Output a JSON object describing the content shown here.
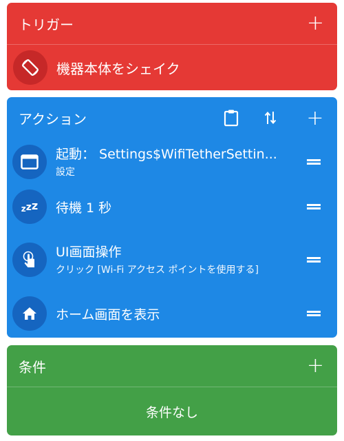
{
  "trigger": {
    "title": "トリガー",
    "items": [
      {
        "label": "機器本体をシェイク",
        "icon": "screen-rotation-icon"
      }
    ]
  },
  "action": {
    "title": "アクション",
    "items": [
      {
        "title": "起動： Settings$WifiTetherSettin...",
        "subtitle": "設定",
        "icon": "window-icon"
      },
      {
        "title": "待機 1 秒",
        "icon": "sleep-zzz-icon"
      },
      {
        "title": "UI画面操作",
        "subtitle": "クリック [Wi-Fi アクセス ポイントを使用する]",
        "icon": "touch-icon"
      },
      {
        "title": "ホーム画面を表示",
        "icon": "home-icon"
      }
    ]
  },
  "constraint": {
    "title": "条件",
    "empty_text": "条件なし"
  },
  "colors": {
    "trigger": "#e53935",
    "action": "#1e88e5",
    "constraint": "#43a047"
  }
}
